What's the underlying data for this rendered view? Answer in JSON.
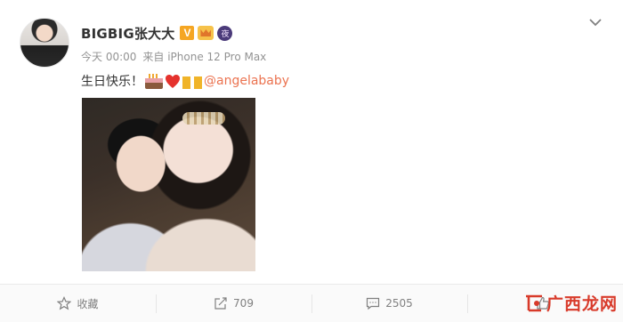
{
  "post": {
    "user_name": "BIGBIG张大大",
    "verified_badge": "V",
    "night_badge": "夜",
    "time": "今天 00:00",
    "source": "来自 iPhone 12 Pro Max",
    "text": "生日快乐！",
    "mention": "@angelababy",
    "emojis": [
      "cake-emoji",
      "heart-emoji",
      "cheers-emoji"
    ]
  },
  "actions": {
    "favorite_label": "收藏",
    "repost_count": "709",
    "comment_count": "2505"
  },
  "watermark": {
    "text": "广西龙网"
  },
  "colors": {
    "mention": "#eb7350",
    "watermark": "#d83a2a",
    "verified": "#f5a623"
  }
}
